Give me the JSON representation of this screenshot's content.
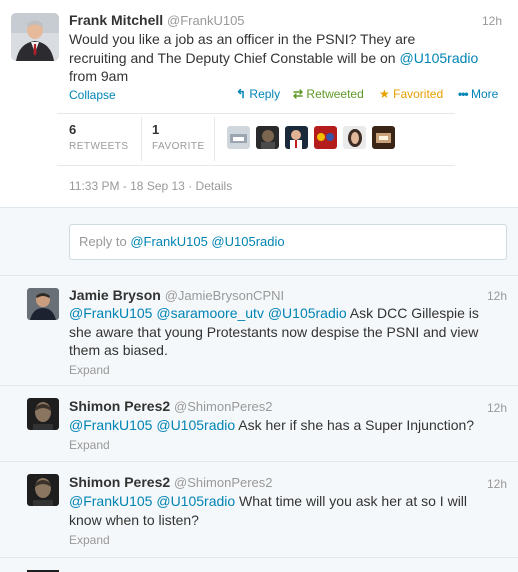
{
  "main_tweet": {
    "name": "Frank Mitchell",
    "handle": "@FrankU105",
    "time": "12h",
    "text_1": "Would you like a job as an officer in the PSNI? They are",
    "text_2": "recruiting and The Deputy Chief Constable will be on ",
    "mention": "@U105radio",
    "text_3": "from 9am",
    "collapse": "Collapse",
    "reply": "Reply",
    "retweeted": "Retweeted",
    "favorited": "Favorited",
    "more": "More",
    "retweets_count": "6",
    "retweets_label": "RETWEETS",
    "favorite_count": "1",
    "favorite_label": "FAVORITE",
    "timestamp": "11:33 PM - 18 Sep 13",
    "details": "Details",
    "dot": "·"
  },
  "reply_box": {
    "prefix": "Reply to ",
    "mentions": "@FrankU105 @U105radio"
  },
  "replies": [
    {
      "name": "Jamie Bryson",
      "handle": "@JamieBrysonCPNI",
      "time": "12h",
      "mentions": "@FrankU105 @saramoore_utv @U105radio",
      "text_a": " Ask DCC Gillespie is",
      "text_b": "she aware that young Protestants now despise the PSNI and view",
      "text_c": "them as biased.",
      "expand": "Expand"
    },
    {
      "name": "Shimon Peres2",
      "handle": "@ShimonPeres2",
      "time": "12h",
      "mentions": "@FrankU105 @U105radio",
      "text_a": " Ask her if she has a Super Injunction?",
      "expand": "Expand"
    },
    {
      "name": "Shimon Peres2",
      "handle": "@ShimonPeres2",
      "time": "12h",
      "mentions": "@FrankU105 @U105radio",
      "text_a": " What time will you ask her at so I will",
      "text_b": "know when to listen?",
      "expand": "Expand"
    }
  ],
  "colors": {
    "link": "#0084b4",
    "retweeted_green": "#609928",
    "favorited_orange": "#e6a000",
    "reply_bg": "#f5f8fa"
  }
}
